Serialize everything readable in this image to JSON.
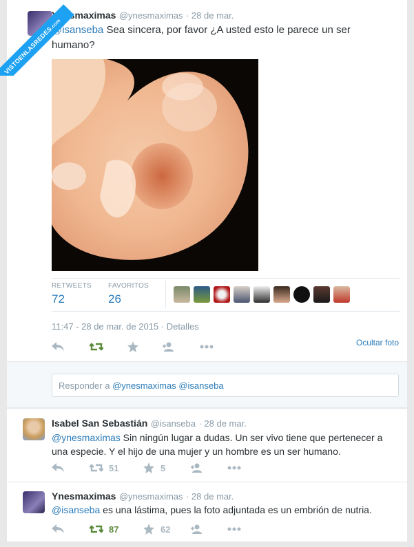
{
  "watermark": {
    "text": "VISTOENLASREDES",
    "sub": ".com"
  },
  "main_tweet": {
    "name": "Ynesmaximas",
    "handle": "@ynesmaximas",
    "date": "· 28 de mar.",
    "mention": "@isanseba",
    "text": " Sea sincera, por favor ¿A usted esto le parece un ser humano?",
    "retweets_label": "RETWEETS",
    "retweets": "72",
    "favorites_label": "FAVORITOS",
    "favorites": "26",
    "timestamp": "11:47 - 28 de mar. de 2015",
    "details": "· Detalles",
    "hide_photo": "Ocultar foto"
  },
  "reply_box": {
    "prefix": "Responder a ",
    "mentions": "@ynesmaximas @isanseba"
  },
  "replies": [
    {
      "name": "Isabel San Sebastián",
      "handle": "@isanseba",
      "date": "· 28 de mar.",
      "mention": "@ynesmaximas",
      "text": " Sin ningún lugar a dudas. Un ser vivo tiene que pertenecer a una especie. Y el hijo de una mujer y un hombre es un ser humano.",
      "retweets": "51",
      "favorites": "5"
    },
    {
      "name": "Ynesmaximas",
      "handle": "@ynesmaximas",
      "date": "· 28 de mar.",
      "mention": "@isanseba",
      "text": " es una lástima, pues la foto adjuntada es un embrión de nutria.",
      "retweets": "87",
      "favorites": "62"
    }
  ],
  "colors": {
    "link": "#2b7bb9",
    "retweet_green": "#5b8a3c",
    "icon_grey": "#aab8c2"
  }
}
